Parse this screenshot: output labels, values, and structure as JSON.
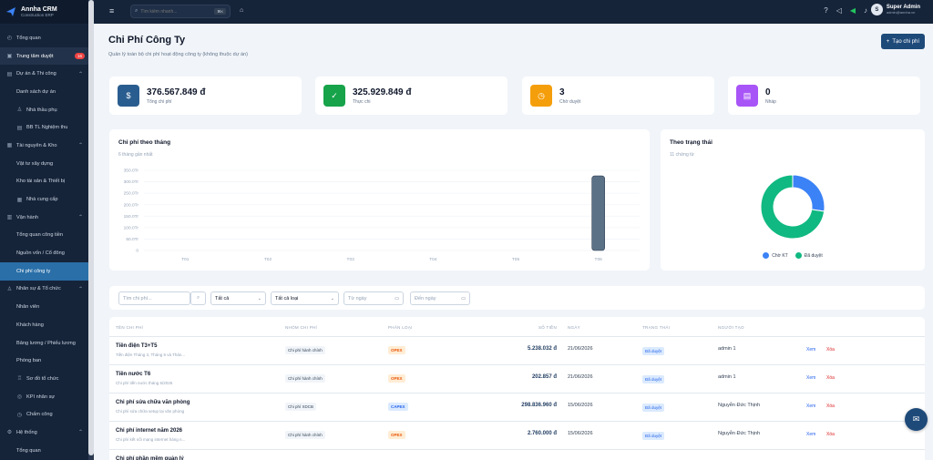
{
  "brand": {
    "name": "Annha CRM",
    "sub": "Construction ERP"
  },
  "sidebar": {
    "items": [
      {
        "label": "Tổng quan",
        "icon": "dashboard-icon",
        "type": "top"
      },
      {
        "label": "Trung tâm duyệt",
        "icon": "inbox-icon",
        "type": "top",
        "badge": "16",
        "highlight": true
      },
      {
        "label": "Dự án & Thi công",
        "icon": "project-icon",
        "type": "group"
      },
      {
        "label": "Danh sách dự án",
        "type": "sub"
      },
      {
        "label": "Nhà thầu phụ",
        "icon": "users-icon",
        "type": "sub"
      },
      {
        "label": "BB TL Nghiệm thu",
        "icon": "file-icon",
        "type": "sub"
      },
      {
        "label": "Tài nguyên & Kho",
        "icon": "box-icon",
        "type": "group"
      },
      {
        "label": "Vật tư xây dựng",
        "type": "sub"
      },
      {
        "label": "Kho tài sản & Thiết bị",
        "type": "sub"
      },
      {
        "label": "Nhà cung cấp",
        "icon": "store-icon",
        "type": "sub"
      },
      {
        "label": "Vận hành",
        "icon": "building-icon",
        "type": "group"
      },
      {
        "label": "Tổng quan công tiền",
        "type": "sub"
      },
      {
        "label": "Nguồn vốn / Cổ đông",
        "type": "sub"
      },
      {
        "label": "Chi phí công ty",
        "type": "sub",
        "active": true
      },
      {
        "label": "Nhân sự & Tổ chức",
        "icon": "people-icon",
        "type": "group"
      },
      {
        "label": "Nhân viên",
        "type": "sub"
      },
      {
        "label": "Khách hàng",
        "type": "sub"
      },
      {
        "label": "Bảng lương / Phiếu lương",
        "type": "sub"
      },
      {
        "label": "Phòng ban",
        "type": "sub"
      },
      {
        "label": "Sơ đồ tổ chức",
        "icon": "org-icon",
        "type": "sub"
      },
      {
        "label": "KPI nhân sự",
        "icon": "target-icon",
        "type": "sub"
      },
      {
        "label": "Chấm công",
        "icon": "clock-icon",
        "type": "sub"
      },
      {
        "label": "Hệ thống",
        "icon": "settings-icon",
        "type": "group"
      },
      {
        "label": "Tổng quan",
        "type": "sub"
      }
    ]
  },
  "topbar": {
    "search_placeholder": "Tìm kiếm nhanh...",
    "search_kbd": "⌘K",
    "user_name": "Super Admin",
    "user_email": "admin@annha.vn",
    "avatar_letter": "S"
  },
  "page": {
    "title": "Chi Phí Công Ty",
    "subtitle": "Quản lý toàn bộ chi phí hoạt động công ty (không thuộc dự án)",
    "create_label": "Tạo chi phí"
  },
  "stats": [
    {
      "value": "376.567.849 đ",
      "label": "Tổng chi phí",
      "color": "#2a5d8f",
      "icon": "dollar-icon"
    },
    {
      "value": "325.929.849 đ",
      "label": "Thực chi",
      "color": "#16a34a",
      "icon": "check-circle-icon"
    },
    {
      "value": "3",
      "label": "Chờ duyệt",
      "color": "#f59e0b",
      "icon": "clock-icon"
    },
    {
      "value": "0",
      "label": "Nháp",
      "color": "#a855f7",
      "icon": "draft-icon"
    }
  ],
  "monthly_card": {
    "title": "Chi phí theo tháng",
    "subtitle": "6 tháng gần nhất"
  },
  "status_card": {
    "title": "Theo trạng thái",
    "subtitle": "11 chứng từ"
  },
  "chart_data": [
    {
      "type": "bar",
      "categories": [
        "T01",
        "T02",
        "T03",
        "T04",
        "T05",
        "T06"
      ],
      "values": [
        0,
        0,
        0,
        0,
        0,
        325.9
      ],
      "ylim": [
        0,
        350
      ],
      "yticks": [
        "0",
        "50.0Tr",
        "100.0Tr",
        "150.0Tr",
        "200.0Tr",
        "250.0Tr",
        "300.0Tr",
        "350.0Tr"
      ],
      "color": "#5b7186"
    },
    {
      "type": "pie",
      "labels": [
        "Chờ KT",
        "Đã duyệt"
      ],
      "values": [
        3,
        8
      ],
      "colors": [
        "#3b82f6",
        "#10b981"
      ]
    }
  ],
  "filters": {
    "search_placeholder": "Tìm chi phí...",
    "status": "Tất cả",
    "type": "Tất cả loại",
    "from_placeholder": "Từ ngày",
    "to_placeholder": "Đến ngày"
  },
  "table": {
    "headers": [
      "TÊN CHI PHÍ",
      "NHÓM CHI PHÍ",
      "PHÂN LOẠI",
      "SỐ TIỀN",
      "NGÀY",
      "TRẠNG THÁI",
      "NGƯỜI TẠO"
    ],
    "actions": {
      "view": "Xem",
      "delete": "Xóa"
    },
    "rows": [
      {
        "name": "Tiền điện T3+T5",
        "desc": "Tiền điện Tháng 3, Tháng 5 và Thán...",
        "group": "Chi phí hành chính",
        "cls": "OPEX",
        "amount": "5.238.032 đ",
        "date": "21/06/2026",
        "status": "Đã duyệt",
        "by": "admin 1"
      },
      {
        "name": "Tiền nước T6",
        "desc": "Chi phí tiền nước tháng 6/2026",
        "group": "Chi phí hành chính",
        "cls": "OPEX",
        "amount": "202.857 đ",
        "date": "21/06/2026",
        "status": "Đã duyệt",
        "by": "admin 1"
      },
      {
        "name": "Chi phí sửa chữa văn phòng",
        "desc": "Chi phí sửa chữa setup lại văn phòng",
        "group": "Chi phí XDCB",
        "cls": "CAPEX",
        "amount": "298.836.960 đ",
        "date": "15/06/2026",
        "status": "Đã duyệt",
        "by": "Nguyễn Đức Thịnh"
      },
      {
        "name": "Chi phí internet năm 2026",
        "desc": "Chi phí kết nối mạng internet hàng n...",
        "group": "Chi phí hành chính",
        "cls": "OPEX",
        "amount": "2.760.000 đ",
        "date": "15/06/2026",
        "status": "Đã duyệt",
        "by": "Nguyễn Đức Thịnh"
      },
      {
        "name": "Chi phí phần mềm quản lý",
        "desc": "",
        "group": "",
        "cls": "",
        "amount": "",
        "date": "",
        "status": "",
        "by": ""
      }
    ]
  }
}
